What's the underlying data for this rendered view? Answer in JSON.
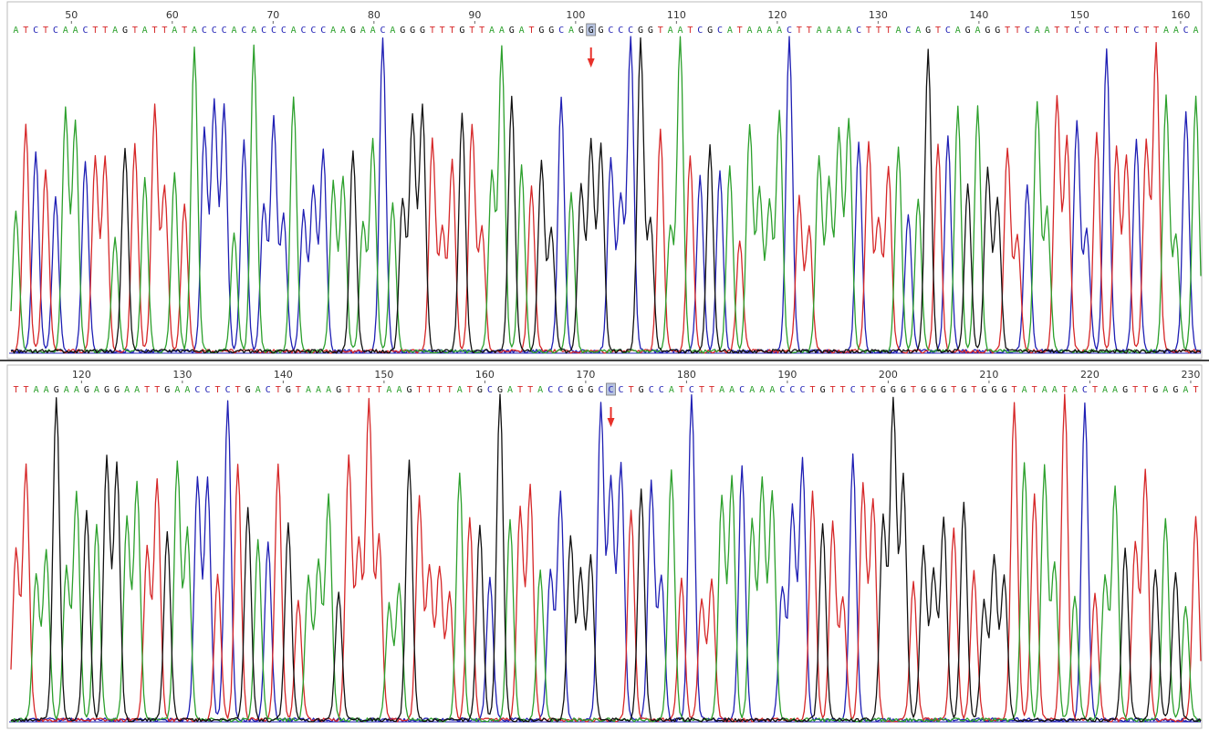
{
  "colors": {
    "A": "#2ca02c",
    "C": "#1f1fb4",
    "G": "#111111",
    "T": "#d62728",
    "marker": "#e8312a",
    "highlight": "#b8c4e0"
  },
  "chart_data": [
    {
      "type": "line",
      "title": "",
      "xlabel": "",
      "ylabel": "",
      "panel": "top",
      "position_ticks": [
        "50",
        "60",
        "70",
        "80",
        "90",
        "100",
        "110",
        "120",
        "130",
        "140",
        "150",
        "160"
      ],
      "tick_positions": [
        50,
        60,
        70,
        80,
        90,
        100,
        110,
        120,
        130,
        140,
        150,
        160
      ],
      "x_range": [
        44,
        162
      ],
      "sequence": "ATCTCAACTTAGTATTATACCCACACCCACCCAAGAACAGGGTTTGTTAAGATGGCAGGGCCCGGTAATCGCATAAAACTTAAAACTTTACAGTCAGAGGTTCAATTCCTCTTCTTAACA",
      "highlighted_position": 101,
      "highlighted_base": "G",
      "grid": false
    },
    {
      "type": "line",
      "title": "",
      "xlabel": "",
      "ylabel": "",
      "panel": "bottom",
      "position_ticks": [
        "120",
        "130",
        "140",
        "150",
        "160",
        "170",
        "180",
        "190",
        "200",
        "210",
        "220",
        "230"
      ],
      "tick_positions": [
        120,
        130,
        140,
        150,
        160,
        170,
        180,
        190,
        200,
        210,
        220,
        230
      ],
      "x_range": [
        113,
        231
      ],
      "sequence": "TTAAGAAGAGGAATTGAACCTCTGACTGTAAAGTTTTAAGTTTTATGCGATTACCGGGCCCTGCCATCTTAACAAACCCTGTTCTTGGGTGGGTGTGGGTATAATACTAAGTTGAGAT",
      "highlighted_position": 172,
      "highlighted_base": "C",
      "grid": false
    }
  ]
}
